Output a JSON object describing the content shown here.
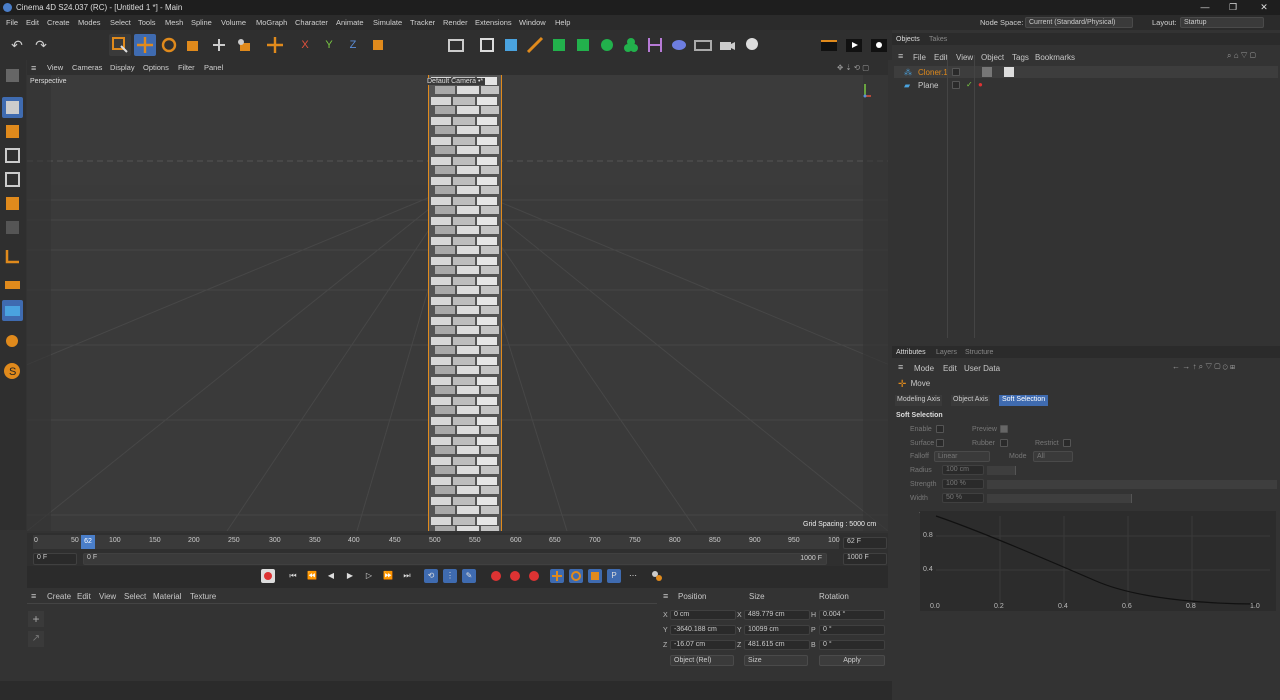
{
  "window": {
    "title": "Cinema 4D S24.037 (RC) - [Untitled 1 *] - Main",
    "min": "—",
    "max": "❐",
    "close": "✕"
  },
  "menu": [
    "File",
    "Edit",
    "Create",
    "Modes",
    "Select",
    "Tools",
    "Mesh",
    "Spline",
    "Volume",
    "MoGraph",
    "Character",
    "Animate",
    "Simulate",
    "Tracker",
    "Render",
    "Extensions",
    "Window",
    "Help"
  ],
  "nodespace": {
    "label": "Node Space:",
    "value": "Current (Standard/Physical)"
  },
  "layout": {
    "label": "Layout:",
    "value": "Startup"
  },
  "viewport": {
    "menu": [
      "View",
      "Cameras",
      "Display",
      "Options",
      "Filter",
      "Panel"
    ],
    "name": "Perspective",
    "camera": "Default Camera •*",
    "grid_spacing": "Grid Spacing : 5000 cm"
  },
  "timeline": {
    "ticks": [
      "0",
      "50",
      "100",
      "150",
      "200",
      "250",
      "300",
      "350",
      "400",
      "450",
      "500",
      "550",
      "600",
      "650",
      "700",
      "750",
      "800",
      "850",
      "900",
      "950",
      "100"
    ],
    "current_marker": "62",
    "current_frame": "62 F",
    "start": "0 F",
    "start2": "0 F",
    "end": "1000 F",
    "end2": "1000 F"
  },
  "material": {
    "menu": [
      "Create",
      "Edit",
      "View",
      "Select",
      "Material",
      "Texture"
    ]
  },
  "coords": {
    "headers": [
      "Position",
      "Size",
      "Rotation"
    ],
    "rows": [
      {
        "axis": "X",
        "pos": "0 cm",
        "saxis": "X",
        "size": "489.779 cm",
        "raxis": "H",
        "rot": "0.004 °"
      },
      {
        "axis": "Y",
        "pos": "-3640.188 cm",
        "saxis": "Y",
        "size": "10099 cm",
        "raxis": "P",
        "rot": "0 °"
      },
      {
        "axis": "Z",
        "pos": "-16.07 cm",
        "saxis": "Z",
        "size": "481.615 cm",
        "raxis": "B",
        "rot": "0 °"
      }
    ],
    "mode": "Object (Rel)",
    "size_mode": "Size",
    "apply": "Apply"
  },
  "objects": {
    "tabs": [
      "Objects",
      "Takes"
    ],
    "menu": [
      "File",
      "Edit",
      "View",
      "Object",
      "Tags",
      "Bookmarks"
    ],
    "items": [
      {
        "name": "Cloner.1"
      },
      {
        "name": "Plane"
      }
    ]
  },
  "attributes": {
    "tabs": [
      "Attributes",
      "Layers",
      "Structure"
    ],
    "menu": [
      "Mode",
      "Edit",
      "User Data"
    ],
    "tool": "Move",
    "subtabs": [
      "Modeling Axis",
      "Object Axis",
      "Soft Selection"
    ],
    "section": "Soft Selection",
    "enable": "Enable",
    "preview": "Preview",
    "surface": "Surface",
    "rubber": "Rubber",
    "restrict": "Restrict",
    "falloff_label": "Falloff",
    "falloff": "Linear",
    "mode_label": "Mode",
    "mode": "All",
    "radius_label": "Radius",
    "radius": "100 cm",
    "strength_label": "Strength",
    "strength": "100 %",
    "width_label": "Width",
    "width": "50 %",
    "graph_y": [
      "0.8",
      "0.4"
    ],
    "graph_x": [
      "0.0",
      "0.2",
      "0.4",
      "0.6",
      "0.8",
      "1.0"
    ]
  },
  "colors": {
    "accent": "#4a7ec9",
    "orange": "#e08a1c",
    "selected_tab": "#3f6bb0"
  }
}
